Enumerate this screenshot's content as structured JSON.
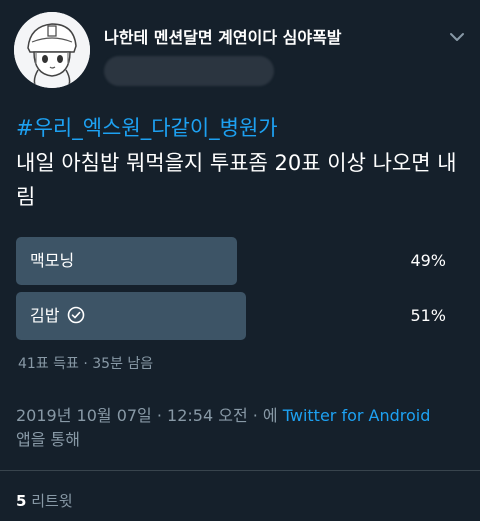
{
  "header": {
    "display_name": "나한테 멘션달면 계연이다 심야폭발",
    "menu_icon": "chevron-down-icon"
  },
  "tweet": {
    "hashtag": "#우리_엑스원_다같이_병원가",
    "text": "내일 아침밥 뭐먹을지 투표좀 20표 이상 나오면 내림"
  },
  "poll": {
    "options": [
      {
        "label": "맥모닝",
        "percent": "49%",
        "fraction": 0.49,
        "winner": false
      },
      {
        "label": "김밥",
        "percent": "51%",
        "fraction": 0.51,
        "winner": true
      }
    ],
    "votes": "41표 득표",
    "separator": "·",
    "time_left": "35분 남음"
  },
  "meta": {
    "timestamp": "2019년 10월 07일 · 12:54 오전 · 에",
    "source": "Twitter for Android",
    "suffix": "앱을 통해"
  },
  "stats": {
    "retweet_count": "5",
    "retweet_label": "리트윗"
  },
  "colors": {
    "background": "#15202b",
    "link": "#1da1f2",
    "bar": "#3d5466",
    "muted": "#8899a6"
  }
}
